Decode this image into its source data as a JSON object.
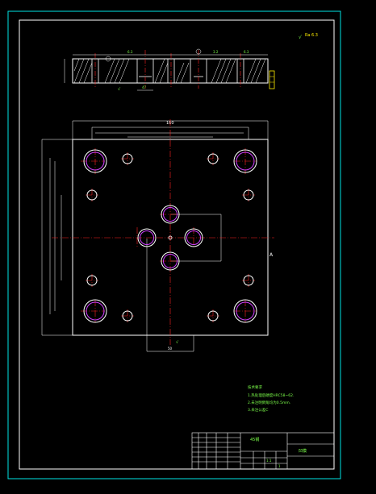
{
  "sheet": {
    "border_color": "#00e5e5",
    "frame_color": "#ffffff",
    "dim_color": "#ffffff",
    "center_line_color": "#ff2020",
    "hole_color": "#d040ff",
    "note_color": "#7cff4a",
    "hatch_color": "#ffffff"
  },
  "top_roughness": {
    "label": "Ra 6.3",
    "symbol": "√"
  },
  "section_view": {
    "roughness_marks": [
      "6.3",
      "3.2",
      "6.3"
    ],
    "bottom_dim": "47"
  },
  "plan_view": {
    "overall_width": "160",
    "side_mark": "A",
    "bottom_dim": "50"
  },
  "tech_notes": {
    "heading": "技术要求",
    "lines": [
      "1.热处理后硬度HRC58~62.",
      "2.未注明倒角均为0.5mm.",
      "3.未注公差C"
    ]
  },
  "title_block": {
    "material": "45钢",
    "part_name": "凹模",
    "scale": "1:1",
    "sheets": "1"
  }
}
